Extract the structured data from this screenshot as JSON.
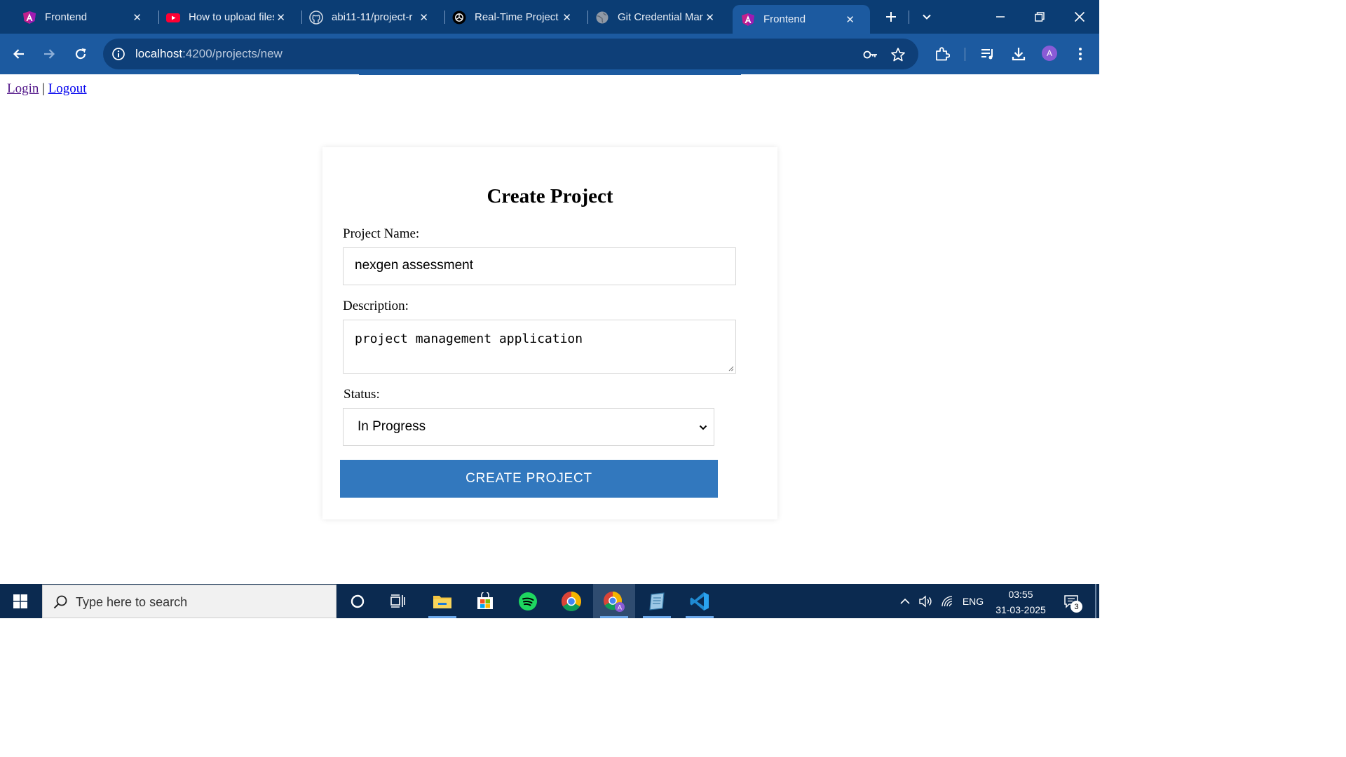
{
  "browser": {
    "tabs": [
      {
        "title": "Frontend",
        "icon": "angular-icon",
        "active": false
      },
      {
        "title": "How to upload files",
        "icon": "youtube-icon",
        "active": false
      },
      {
        "title": "abi11-11/project-r",
        "icon": "github-icon",
        "active": false
      },
      {
        "title": "Real-Time Project",
        "icon": "chatgpt-icon",
        "active": false
      },
      {
        "title": "Git Credential Man",
        "icon": "globe-icon",
        "active": false
      },
      {
        "title": "Frontend",
        "icon": "angular-icon",
        "active": true
      }
    ],
    "url_host": "localhost",
    "url_path": ":4200/projects/new",
    "profile_initial": "A",
    "colors": {
      "tabbar": "#0b3d74",
      "toolbar": "#1c5aa0",
      "omnibox": "#0e3f78"
    }
  },
  "page": {
    "auth": {
      "login": "Login",
      "separator": "|",
      "logout": "Logout"
    },
    "form": {
      "title": "Create Project",
      "name_label": "Project Name:",
      "name_value": "nexgen assessment",
      "description_label": "Description:",
      "description_value": "project management application",
      "status_label": "Status:",
      "status_value": "In Progress",
      "submit_label": "CREATE PROJECT",
      "submit_color": "#3278be"
    }
  },
  "taskbar": {
    "search_placeholder": "Type here to search",
    "apps": [
      "cortana-icon",
      "task-view-icon",
      "file-explorer-icon",
      "microsoft-store-icon",
      "spotify-icon",
      "chrome-icon",
      "chrome-profile-icon",
      "notepad-icon",
      "vscode-icon"
    ],
    "language": "ENG",
    "time": "03:55",
    "date": "31-03-2025",
    "notification_count": "3"
  }
}
